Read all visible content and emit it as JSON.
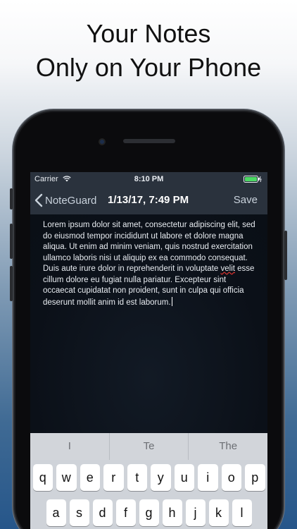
{
  "headline": {
    "line1": "Your Notes",
    "line2": "Only on Your Phone"
  },
  "statusbar": {
    "carrier": "Carrier",
    "time": "8:10 PM"
  },
  "navbar": {
    "back_label": "NoteGuard",
    "title": "1/13/17, 7:49 PM",
    "save_label": "Save"
  },
  "note": {
    "text_before": "Lorem ipsum dolor sit amet, consectetur adipiscing elit, sed do eiusmod tempor incididunt ut labore et dolore magna aliqua. Ut enim ad minim veniam, quis nostrud exercitation ullamco laboris nisi ut aliquip ex ea commodo consequat. Duis aute irure dolor in reprehenderit in voluptate ",
    "misspelled": "velit",
    "text_after": " esse cillum dolore eu fugiat nulla pariatur. Excepteur sint occaecat cupidatat non proident, sunt in culpa qui officia deserunt mollit anim id est laborum."
  },
  "keyboard": {
    "suggestions": [
      "I",
      "Te",
      "The"
    ],
    "row1": [
      "q",
      "w",
      "e",
      "r",
      "t",
      "y",
      "u",
      "i",
      "o",
      "p"
    ],
    "row2": [
      "a",
      "s",
      "d",
      "f",
      "g",
      "h",
      "j",
      "k",
      "l"
    ]
  },
  "colors": {
    "bar_background": "#2a323d",
    "editor_background": "#0b1018",
    "misspelling_underline": "#e0332f"
  },
  "icons": {
    "wifi": "wifi-icon",
    "battery": "battery-icon",
    "back": "chevron-left-icon"
  }
}
